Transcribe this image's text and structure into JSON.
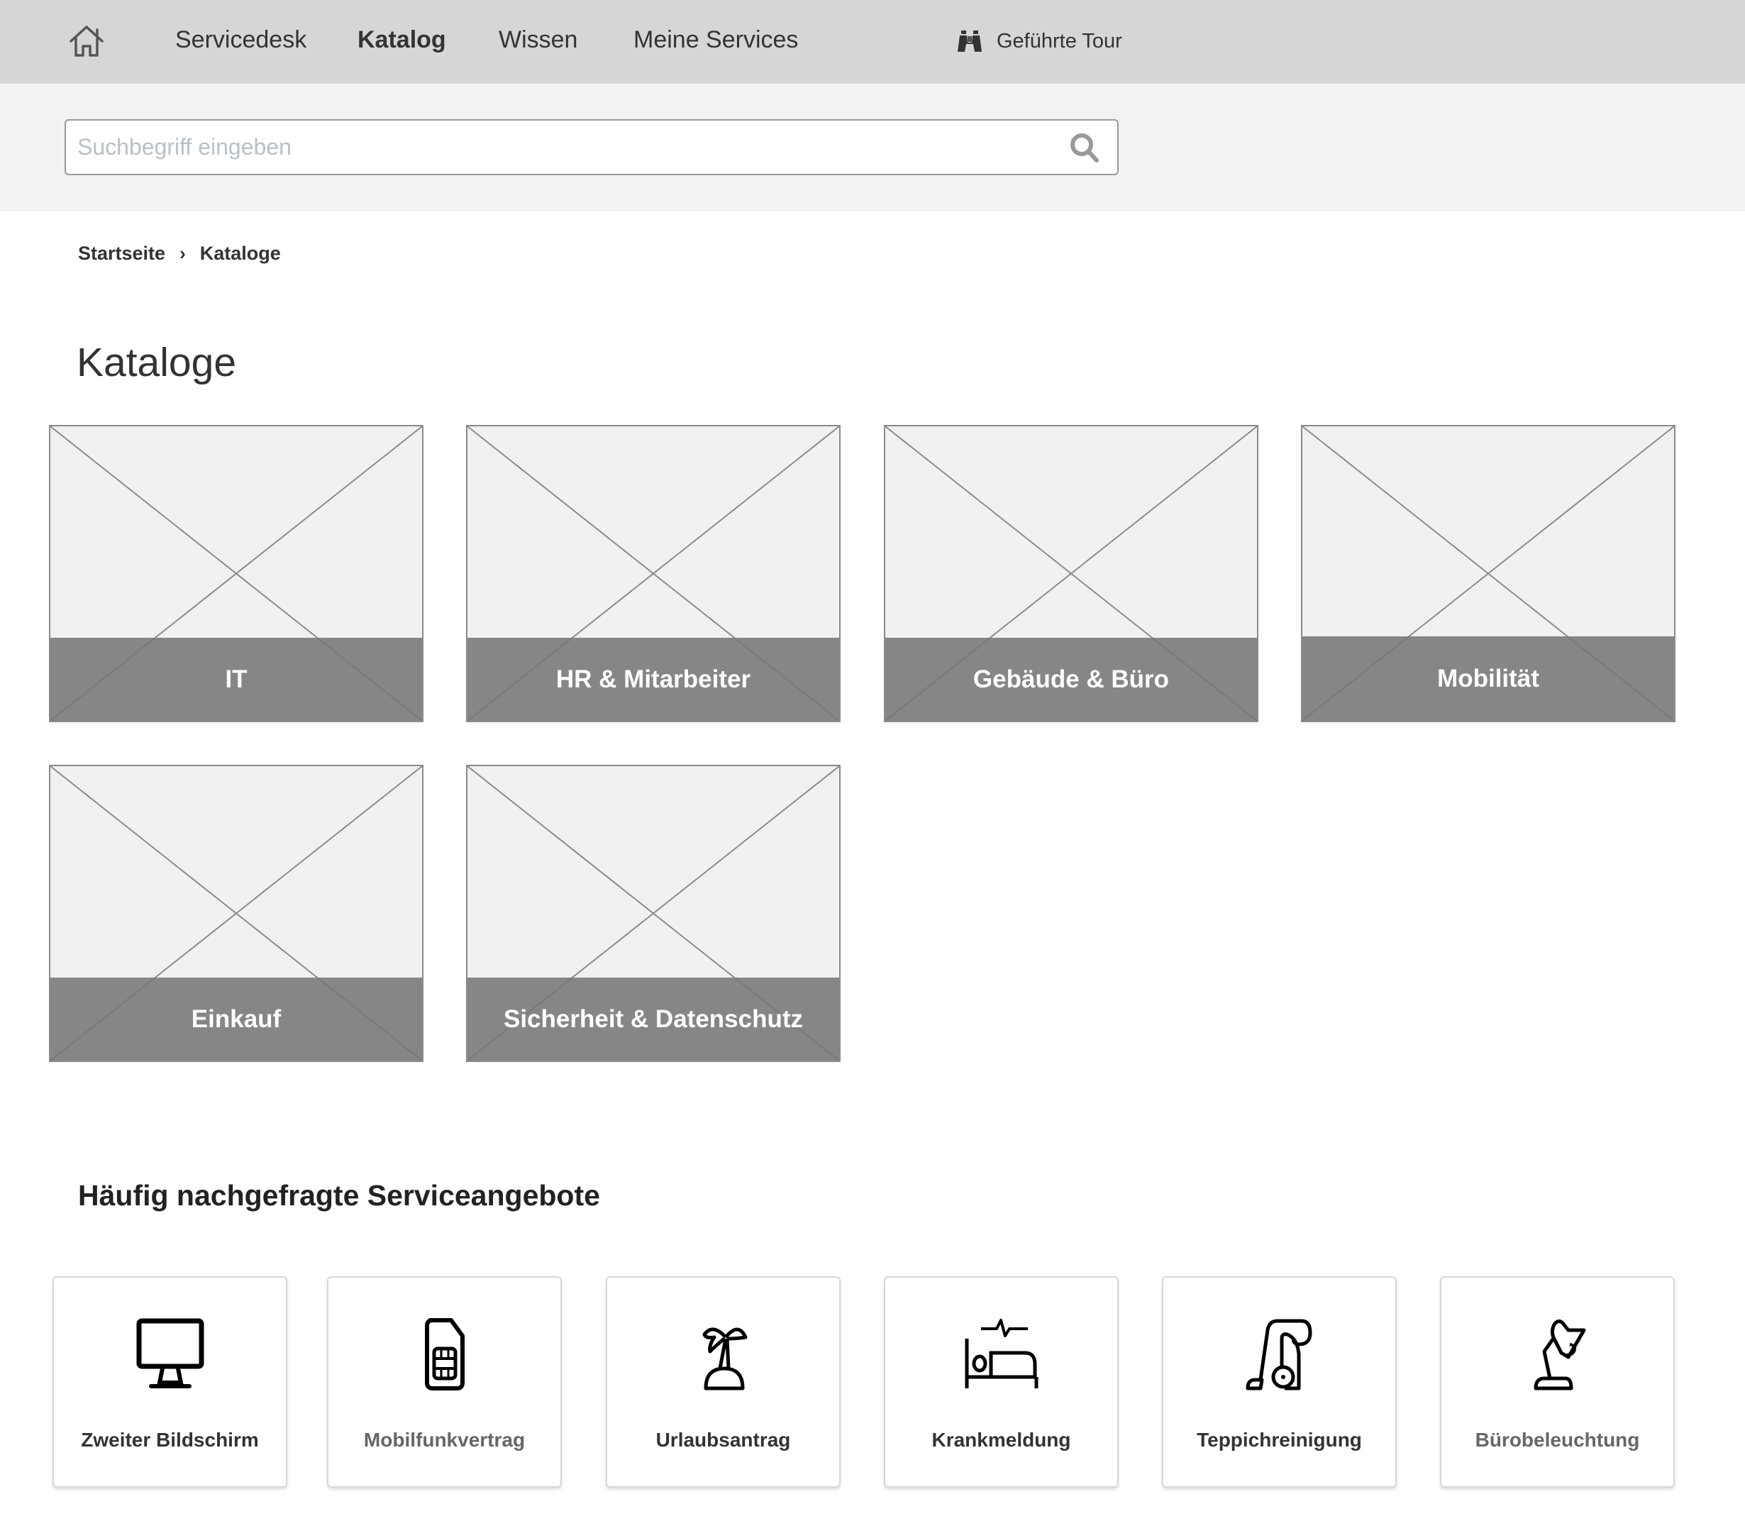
{
  "nav": {
    "home_icon": "home-icon",
    "items": [
      {
        "label": "Servicedesk",
        "active": false
      },
      {
        "label": "Katalog",
        "active": true
      },
      {
        "label": "Wissen",
        "active": false
      },
      {
        "label": "Meine Services",
        "active": false
      }
    ],
    "tour": {
      "icon": "binoculars-icon",
      "label": "Geführte Tour"
    }
  },
  "search": {
    "placeholder": "Suchbegriff eingeben",
    "value": "",
    "icon": "search-icon"
  },
  "breadcrumb": {
    "items": [
      "Startseite",
      "Kataloge"
    ],
    "separator": "›"
  },
  "page_title": "Kataloge",
  "catalogs": [
    {
      "label": "IT"
    },
    {
      "label": "HR & Mitarbeiter"
    },
    {
      "label": "Gebäude & Büro"
    },
    {
      "label": "Mobilität"
    },
    {
      "label": "Einkauf"
    },
    {
      "label": "Sicherheit & Datenschutz"
    }
  ],
  "services_section": {
    "title": "Häufig nachgefragte Serviceangebote",
    "items": [
      {
        "label": "Zweiter Bildschirm",
        "icon": "monitor-icon",
        "muted": false
      },
      {
        "label": "Mobilfunkvertrag",
        "icon": "sim-card-icon",
        "muted": true
      },
      {
        "label": "Urlaubsantrag",
        "icon": "palm-tree-island-icon",
        "muted": false
      },
      {
        "label": "Krankmeldung",
        "icon": "sick-bed-icon",
        "muted": false
      },
      {
        "label": "Teppichreinigung",
        "icon": "vacuum-cleaner-icon",
        "muted": false
      },
      {
        "label": "Bürobeleuchtung",
        "icon": "desk-lamp-icon",
        "muted": true
      }
    ]
  },
  "colors": {
    "nav_bg": "#d6d6d6",
    "search_band_bg": "#f2f2f2",
    "catalog_label_bg": "#828282",
    "text": "#333333",
    "muted_text": "#666666",
    "placeholder": "#b9c0c6"
  }
}
